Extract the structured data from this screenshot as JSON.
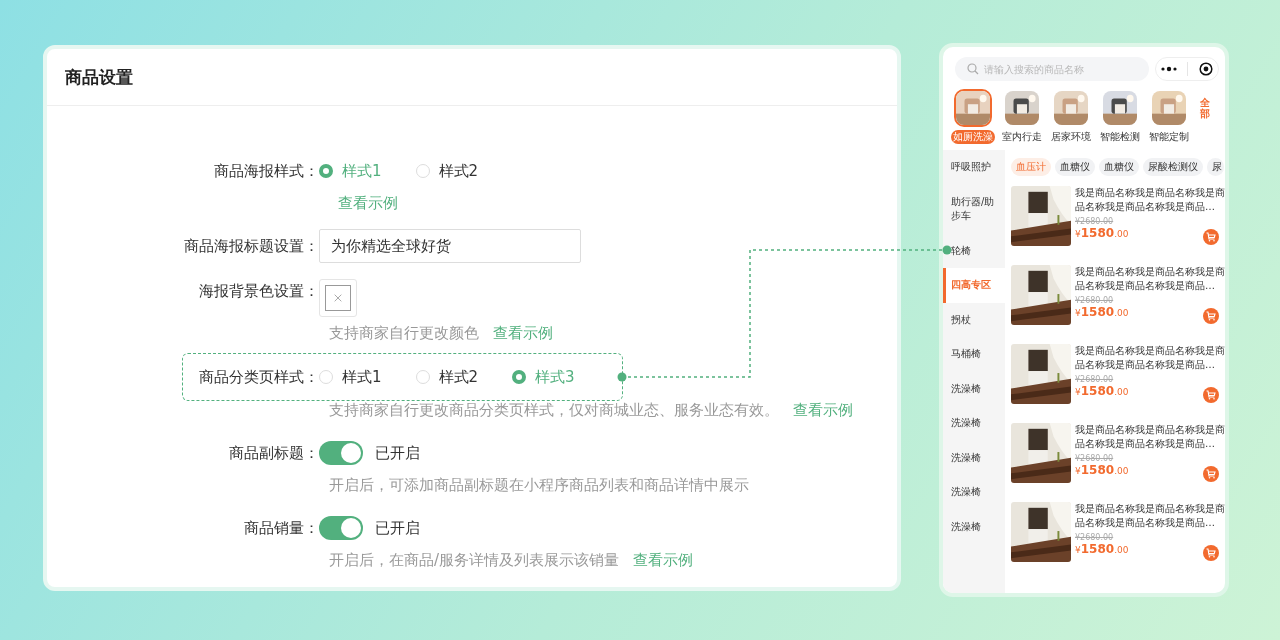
{
  "settings": {
    "title": "商品设置",
    "rows": [
      {
        "kind": "radio",
        "label": "商品海报样式：",
        "highlighted": false,
        "options": [
          {
            "label": "样式1",
            "selected": true
          },
          {
            "label": "样式2",
            "selected": false
          }
        ],
        "link": "查看示例"
      },
      {
        "kind": "input",
        "label": "商品海报标题设置：",
        "highlighted": false,
        "value": "为你精选全球好货"
      },
      {
        "kind": "color",
        "label": "海报背景色设置：",
        "highlighted": false,
        "note": "支持商家自行更改颜色",
        "link": "查看示例"
      },
      {
        "kind": "radio",
        "label": "商品分类页样式：",
        "highlighted": true,
        "options": [
          {
            "label": "样式1",
            "selected": false
          },
          {
            "label": "样式2",
            "selected": false
          },
          {
            "label": "样式3",
            "selected": true
          }
        ],
        "note": "支持商家自行更改商品分类页样式，仅对商城业态、服务业态有效。",
        "link": "查看示例"
      },
      {
        "kind": "switch",
        "label": "商品副标题：",
        "highlighted": false,
        "on": true,
        "status": "已开启",
        "note": "开启后，可添加商品副标题在小程序商品列表和商品详情中展示"
      },
      {
        "kind": "switch",
        "label": "商品销量：",
        "highlighted": false,
        "on": true,
        "status": "已开启",
        "note": "开启后，在商品/服务详情及列表展示该销量",
        "link": "查看示例"
      }
    ]
  },
  "preview": {
    "search": {
      "placeholder": "请输入搜索的商品名称"
    },
    "categories": [
      {
        "label": "如厕洗澡",
        "selected": true
      },
      {
        "label": "室内行走",
        "selected": false
      },
      {
        "label": "居家环境",
        "selected": false
      },
      {
        "label": "智能检测",
        "selected": false
      },
      {
        "label": "智能定制",
        "selected": false
      }
    ],
    "all_button": "全部",
    "sidebar": [
      {
        "label": "呼吸照护",
        "selected": false
      },
      {
        "label": "助行器/助步车",
        "selected": false
      },
      {
        "label": "轮椅",
        "selected": false
      },
      {
        "label": "四高专区",
        "selected": true
      },
      {
        "label": "拐杖",
        "selected": false
      },
      {
        "label": "马桶椅",
        "selected": false
      },
      {
        "label": "洗澡椅",
        "selected": false
      },
      {
        "label": "洗澡椅",
        "selected": false
      },
      {
        "label": "洗澡椅",
        "selected": false
      },
      {
        "label": "洗澡椅",
        "selected": false
      },
      {
        "label": "洗澡椅",
        "selected": false
      }
    ],
    "chips": [
      {
        "label": "血压计",
        "selected": true
      },
      {
        "label": "血糖仪",
        "selected": false
      },
      {
        "label": "血糖仪",
        "selected": false
      },
      {
        "label": "尿酸检测仪",
        "selected": false
      },
      {
        "label": "尿",
        "selected": false
      }
    ],
    "products": [
      {
        "name": "我是商品名称我是商品名称我是商品名称我是商品名称我是商品…",
        "original_price": "¥2680.00",
        "currency": "¥",
        "price": "1580",
        "decimals": ".00"
      },
      {
        "name": "我是商品名称我是商品名称我是商品名称我是商品名称我是商品…",
        "original_price": "¥2680.00",
        "currency": "¥",
        "price": "1580",
        "decimals": ".00"
      },
      {
        "name": "我是商品名称我是商品名称我是商品名称我是商品名称我是商品…",
        "original_price": "¥2680.00",
        "currency": "¥",
        "price": "1580",
        "decimals": ".00"
      },
      {
        "name": "我是商品名称我是商品名称我是商品名称我是商品名称我是商品…",
        "original_price": "¥2680.00",
        "currency": "¥",
        "price": "1580",
        "decimals": ".00"
      },
      {
        "name": "我是商品名称我是商品名称我是商品名称我是商品名称我是商品…",
        "original_price": "¥2680.00",
        "currency": "¥",
        "price": "1580",
        "decimals": ".00"
      }
    ]
  }
}
